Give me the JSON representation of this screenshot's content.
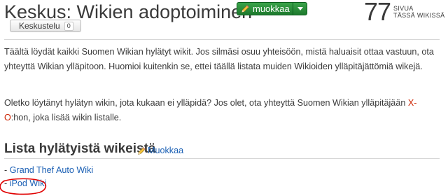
{
  "header": {
    "title": "Keskus: Wikien adoptoiminen",
    "edit_label": "muokkaa",
    "page_count": "77",
    "page_count_label_line1": "SIVUA",
    "page_count_label_line2": "TÄSSÄ WIKISSÄ",
    "talk_label": "Keskustelu",
    "talk_count": "0"
  },
  "content": {
    "paragraph1": "Täältä löydät kaikki Suomen Wikian hylätyt wikit. Jos silmäsi osuu yhteisöön, mistä haluaisit ottaa vastuun, ota yhteyttä Wikian ylläpitoon. Huomioi kuitenkin se, ettei täällä listata muiden Wikioiden ylläpitäjättömiä wikejä.",
    "paragraph2_before": "Oletko löytänyt hylätyn wikin, jota kukaan ei ylläpidä? Jos olet, ota yhteyttä Suomen Wikian ylläpitäjään ",
    "paragraph2_link": "X-O",
    "paragraph2_after": ":hon, joka lisää wikin listalle."
  },
  "section": {
    "title": "Lista hylätyistä wikeistä",
    "edit_label": "Muokkaa"
  },
  "wiki_list": [
    {
      "prefix": "- ",
      "name": "Grand Thef Auto Wiki"
    },
    {
      "prefix": "- ",
      "name": "iPod Wiki"
    }
  ],
  "colors": {
    "edit_button": "#1e7a2e",
    "link": "#1a5fb4",
    "red_link": "#cc2200",
    "annotation_circle": "#e00000"
  },
  "icons": {
    "edit": "pencil-icon",
    "dropdown": "chevron-down-icon"
  }
}
